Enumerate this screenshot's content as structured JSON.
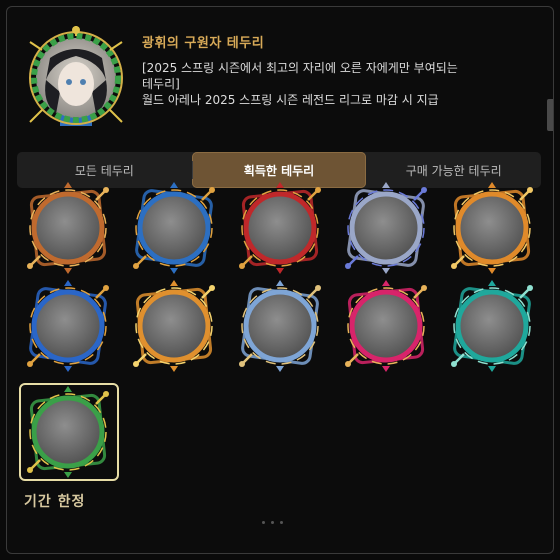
{
  "header": {
    "title": "광휘의 구원자 테두리",
    "description": "[2025 스프링 시즌에서 최고의 자리에 오른 자에게만 부여되는\n테두리]\n월드 아레나 2025 스프링 시즌 레전드 리그로 마감 시 지급",
    "preview_icon": "portrait-frame-icon"
  },
  "tabs": [
    {
      "label": "모든 테두리",
      "active": false
    },
    {
      "label": "획득한 테두리",
      "active": true
    },
    {
      "label": "구매 가능한 테두리",
      "active": false
    }
  ],
  "frames": [
    {
      "icon": "bronze-frame-icon",
      "color": "#c06a2e",
      "accent": "#e8b35a"
    },
    {
      "icon": "sapphire-frame-icon",
      "color": "#2c6fc2",
      "accent": "#e0a240"
    },
    {
      "icon": "ruby-frame-icon",
      "color": "#c0282a",
      "accent": "#e0a240"
    },
    {
      "icon": "silver-frame-icon",
      "color": "#9aa7c8",
      "accent": "#6a7ad8"
    },
    {
      "icon": "gold-frame-icon",
      "color": "#e08a2a",
      "accent": "#f1c866"
    },
    {
      "icon": "blue-chain-frame-icon",
      "color": "#2a66c8",
      "accent": "#e0a240"
    },
    {
      "icon": "golden-ring-frame-icon",
      "color": "#e0902e",
      "accent": "#f4d36e"
    },
    {
      "icon": "steel-blue-frame-icon",
      "color": "#7ea5d6",
      "accent": "#e0c27c"
    },
    {
      "icon": "crimson-frame-icon",
      "color": "#d8246a",
      "accent": "#e8b35a"
    },
    {
      "icon": "teal-frame-icon",
      "color": "#1fa89c",
      "accent": "#8fe0d0"
    },
    {
      "icon": "laurel-frame-icon",
      "color": "#3aa048",
      "accent": "#e0c24a"
    }
  ],
  "limited_label": "기간 한정",
  "colors": {
    "accent": "#d8aa58",
    "active_tab": "#6e5434",
    "selected_border": "#e7dda6"
  }
}
